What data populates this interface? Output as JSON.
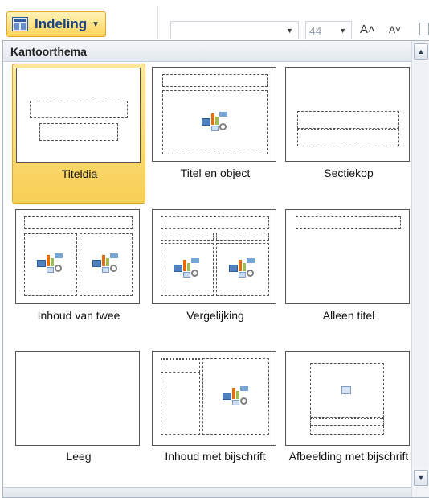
{
  "ribbon": {
    "layout_button_label": "Indeling",
    "font_size_value": "44",
    "grow_font_label": "A˄",
    "shrink_font_label": "A˅"
  },
  "gallery": {
    "section_title": "Kantoorthema",
    "layouts": [
      {
        "label": "Titeldia",
        "selected": true
      },
      {
        "label": "Titel en object",
        "selected": false
      },
      {
        "label": "Sectiekop",
        "selected": false
      },
      {
        "label": "Inhoud van twee",
        "selected": false
      },
      {
        "label": "Vergelijking",
        "selected": false
      },
      {
        "label": "Alleen titel",
        "selected": false
      },
      {
        "label": "Leeg",
        "selected": false
      },
      {
        "label": "Inhoud met bijschrift",
        "selected": false
      },
      {
        "label": "Afbeelding met bijschrift",
        "selected": false
      }
    ]
  },
  "colors": {
    "selection": "#f8cf55",
    "selection_border": "#e1a52c",
    "header_text": "#15428b"
  },
  "icons": {
    "layout_button": "slide-layout-icon",
    "scroll_up": "arrow-up-icon",
    "scroll_down": "arrow-down-icon",
    "content_placeholder": "content-placeholder-icon",
    "picture_placeholder": "picture-placeholder-icon"
  }
}
